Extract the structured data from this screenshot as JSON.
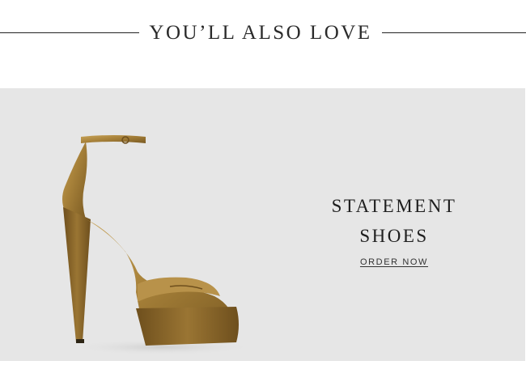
{
  "header": {
    "title": "YOU’LL ALSO LOVE"
  },
  "promo": {
    "headline_line1": "STATEMENT",
    "headline_line2": "SHOES",
    "cta_label": "ORDER NOW",
    "image_subject": "gold metallic platform ankle-strap sandal",
    "background_color": "#e6e6e6",
    "shoe_color": "#a8823a"
  }
}
